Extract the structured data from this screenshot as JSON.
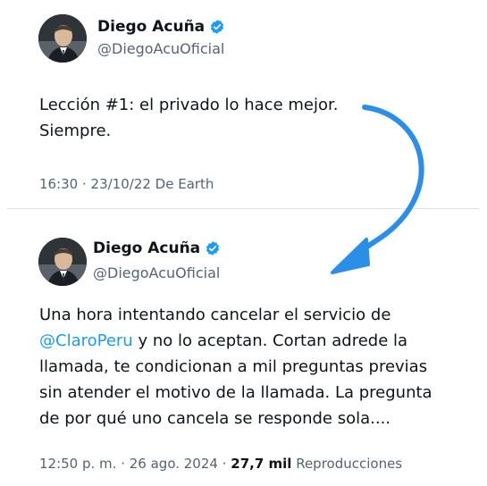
{
  "tweets": [
    {
      "display_name": "Diego Acuña",
      "handle": "@DiegoAcuOficial",
      "text_lines": [
        "Lección #1: el privado lo hace mejor.",
        "Siempre."
      ],
      "timestamp": "16:30 · 23/10/22 De Earth"
    },
    {
      "display_name": "Diego Acuña",
      "handle": "@DiegoAcuOficial",
      "text_line_1": "Una hora intentando cancelar el servicio de",
      "mention": "@ClaroPeru",
      "text_after_mention": " y no lo aceptan. Cortan adrede la",
      "text_line_3": "llamada, te condicionan a mil preguntas previas",
      "text_line_4": "sin atender el motivo de la llamada. La pregunta",
      "text_line_5": "de por qué uno cancela se responde sola....",
      "time": "12:50 p. m.",
      "separator": " · ",
      "date": "26 ago. 2024",
      "separator_2": " · ",
      "views_count": "27,7 mil",
      "views_label": " Reproducciones"
    }
  ],
  "colors": {
    "accent": "#1d9bf0",
    "text": "#0f1419",
    "secondary": "#536471",
    "arrow": "#2b8fe8"
  },
  "icons": {
    "verified": "verified-badge-icon",
    "arrow": "curved-arrow-icon"
  }
}
